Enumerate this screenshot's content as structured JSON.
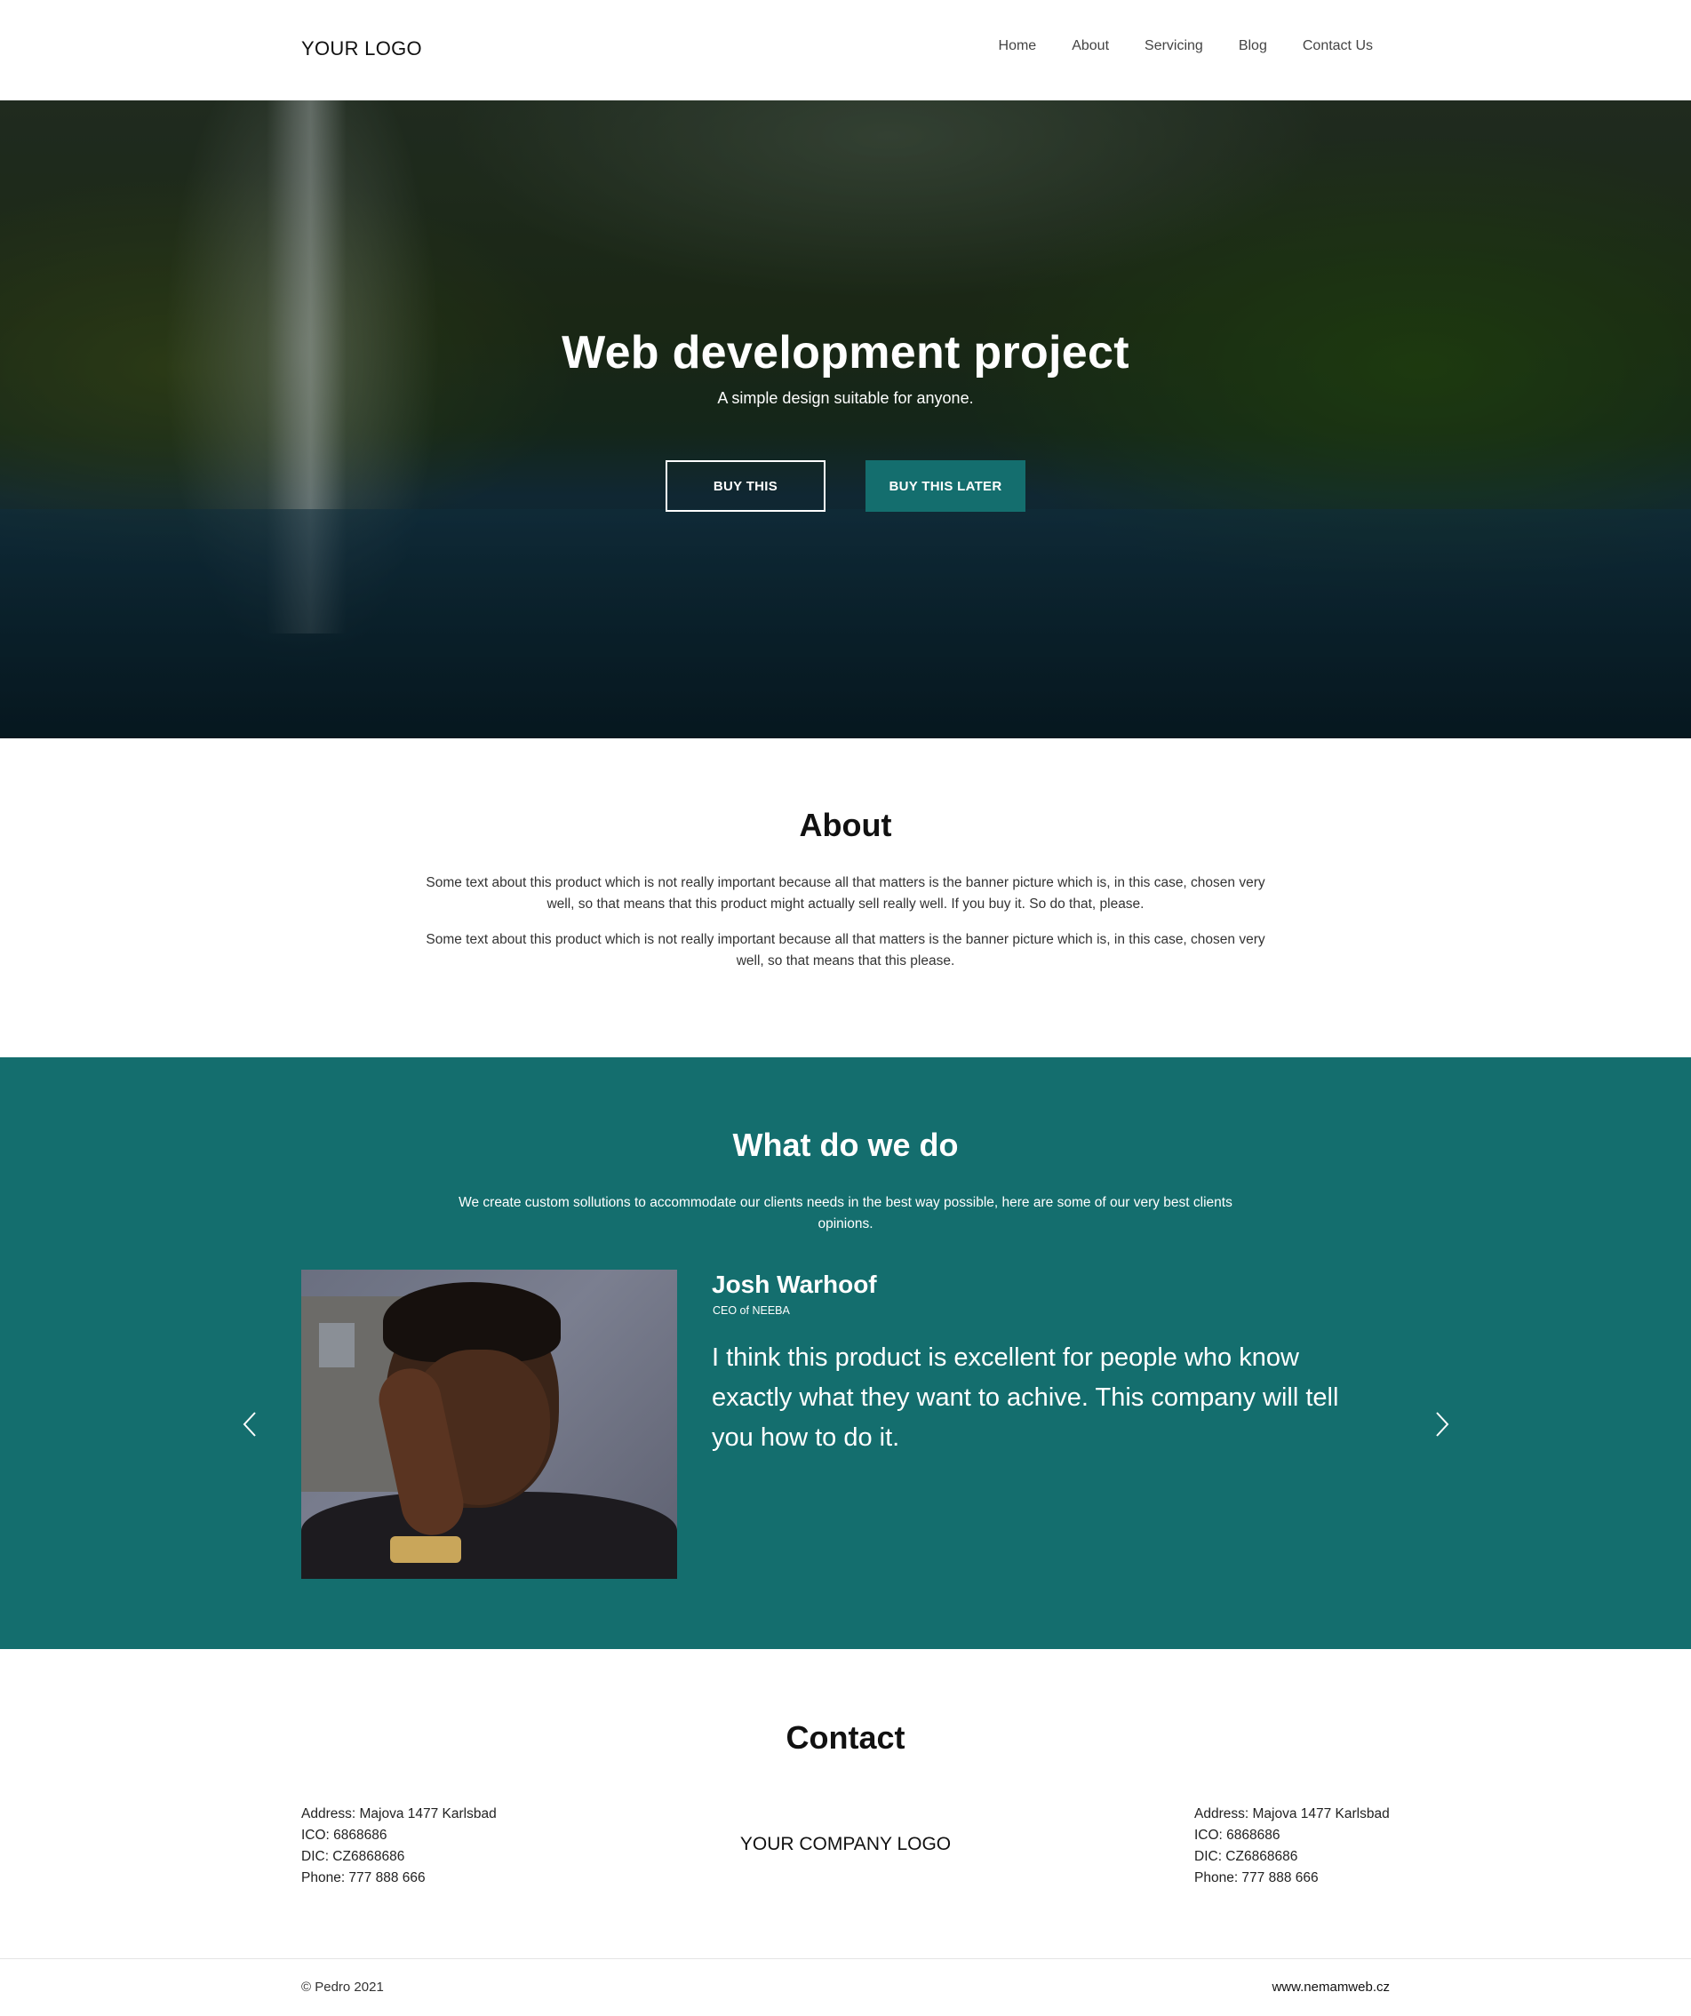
{
  "header": {
    "logo": "YOUR LOGO",
    "nav": [
      "Home",
      "About",
      "Servicing",
      "Blog",
      "Contact Us"
    ]
  },
  "hero": {
    "title": "Web development project",
    "subtitle": "A simple design suitable for anyone.",
    "buy_label": "BUY THIS",
    "buy_later_label": "BUY THIS LATER"
  },
  "about": {
    "title": "About",
    "paragraphs": [
      "Some text about this product which is not really important because all that matters is the banner picture which is, in this case, chosen very well, so that means that this product might actually sell really well. If you buy it. So do that, please.",
      "Some text about this product which is not really important because all that matters is the banner picture which is, in this case, chosen very well, so that means that this please."
    ]
  },
  "services": {
    "title": "What do we do",
    "intro": "We create custom sollutions to accommodate our clients needs in the best way possible, here are some of our very best clients opinions.",
    "testimonial": {
      "name": "Josh Warhoof",
      "role": "CEO of NEEBA",
      "quote": "I think this product is excellent for people who know exactly what they want to achive. This company will tell you how to do it."
    }
  },
  "contact": {
    "title": "Contact",
    "left": [
      "Address: Majova 1477 Karlsbad",
      "ICO: 6868686",
      "DIC: CZ6868686",
      "Phone: 777 888 666"
    ],
    "company_logo": "YOUR COMPANY LOGO",
    "right": [
      "Address: Majova 1477 Karlsbad",
      "ICO: 6868686",
      "DIC: CZ6868686",
      "Phone: 777 888 666"
    ]
  },
  "footer": {
    "copyright": "© Pedro 2021",
    "site": "www.nemamweb.cz"
  },
  "colors": {
    "accent": "#146e6e",
    "text": "#222222",
    "background": "#ffffff"
  },
  "icons": {
    "prev": "chevron-left-icon",
    "next": "chevron-right-icon"
  }
}
